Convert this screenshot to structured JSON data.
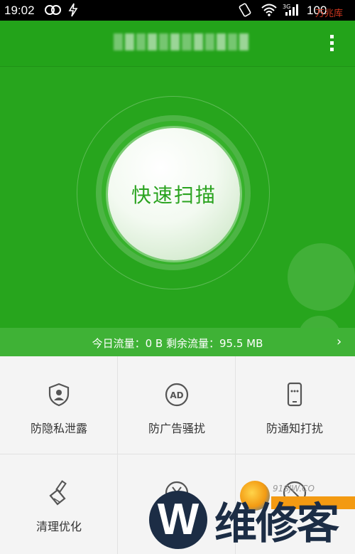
{
  "status_bar": {
    "time": "19:02",
    "battery": "100",
    "watermark": "万兆库"
  },
  "header": {
    "menu_icon": "more-vert-icon"
  },
  "hero": {
    "scan_label": "快速扫描"
  },
  "traffic": {
    "text": "今日流量：0 B   剩余流量：95.5 MB",
    "chevron": "›"
  },
  "features": [
    {
      "label": "防隐私泄露",
      "icon": "user-shield-icon"
    },
    {
      "label": "防广告骚扰",
      "icon": "ad-icon"
    },
    {
      "label": "防通知打扰",
      "icon": "phone-notice-icon"
    },
    {
      "label": "清理优化",
      "icon": "broom-icon"
    },
    {
      "label": "",
      "icon": "yen-icon"
    },
    {
      "label": "",
      "icon": "cancel-icon"
    }
  ],
  "watermarks": {
    "logo_letter": "W",
    "logo_text": "维修客",
    "site": "91SJW.CO"
  },
  "colors": {
    "header_green": "#23a31a",
    "hero_green": "#27a51d",
    "traffic_green": "#3fb236",
    "accent_green": "#2aa31f"
  }
}
